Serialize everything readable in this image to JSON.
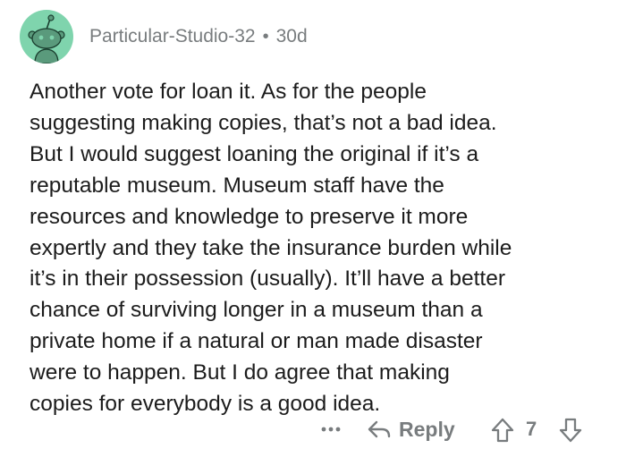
{
  "comment": {
    "author": "Particular-Studio-32",
    "separator": "•",
    "age": "30d",
    "body_lines": [
      "Another vote for loan it. As for the people",
      "suggesting making copies, that’s not a bad idea.",
      "But I would suggest loaning the original if it’s a",
      "reputable museum. Museum staff have the",
      "resources and knowledge  to preserve it more",
      "expertly and they take the insurance burden while",
      "it’s in their possession (usually). It’ll have a better",
      "chance of surviving longer in a museum than a",
      "private home if a natural or man made disaster",
      "were to happen. But I do agree that making",
      "copies for everybody is a good idea."
    ],
    "avatar_icon": "snoo-avatar-icon",
    "avatar_color": "#7fd4ad"
  },
  "actions": {
    "more_icon": "ellipsis-icon",
    "reply_label": "Reply",
    "reply_icon": "reply-arrow-icon",
    "upvote_icon": "upvote-arrow-icon",
    "score": "7",
    "downvote_icon": "downvote-arrow-icon"
  }
}
